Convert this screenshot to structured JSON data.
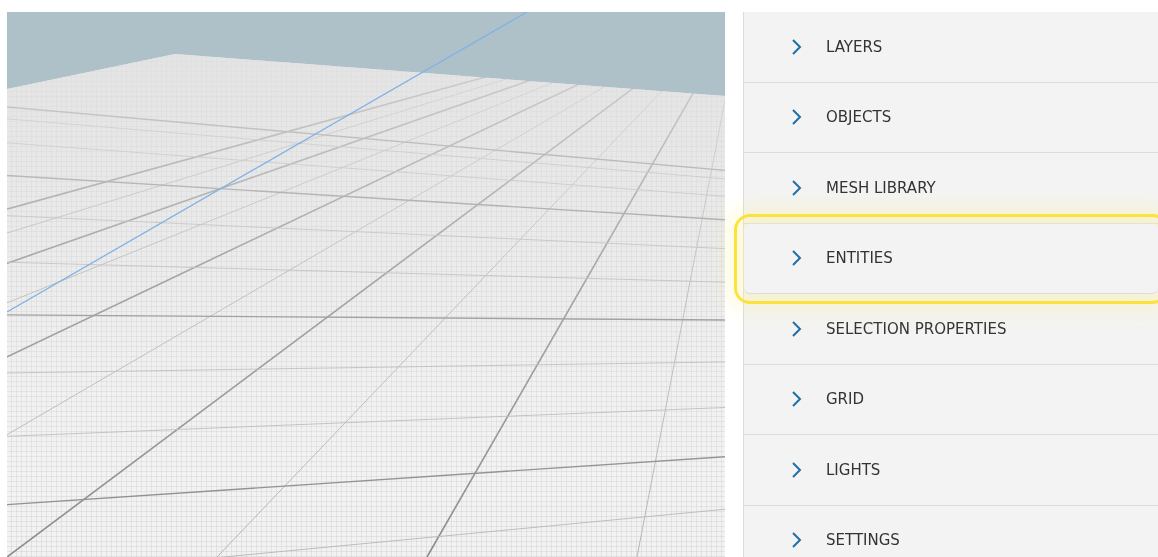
{
  "viewport": {
    "kind": "grid-floor"
  },
  "panel": {
    "sections": [
      {
        "label": "LAYERS",
        "expanded": false,
        "highlighted": false
      },
      {
        "label": "OBJECTS",
        "expanded": false,
        "highlighted": false
      },
      {
        "label": "MESH LIBRARY",
        "expanded": false,
        "highlighted": false
      },
      {
        "label": "ENTITIES",
        "expanded": false,
        "highlighted": true
      },
      {
        "label": "SELECTION PROPERTIES",
        "expanded": false,
        "highlighted": false
      },
      {
        "label": "GRID",
        "expanded": false,
        "highlighted": false
      },
      {
        "label": "LIGHTS",
        "expanded": false,
        "highlighted": false
      },
      {
        "label": "SETTINGS",
        "expanded": false,
        "highlighted": false
      }
    ]
  }
}
